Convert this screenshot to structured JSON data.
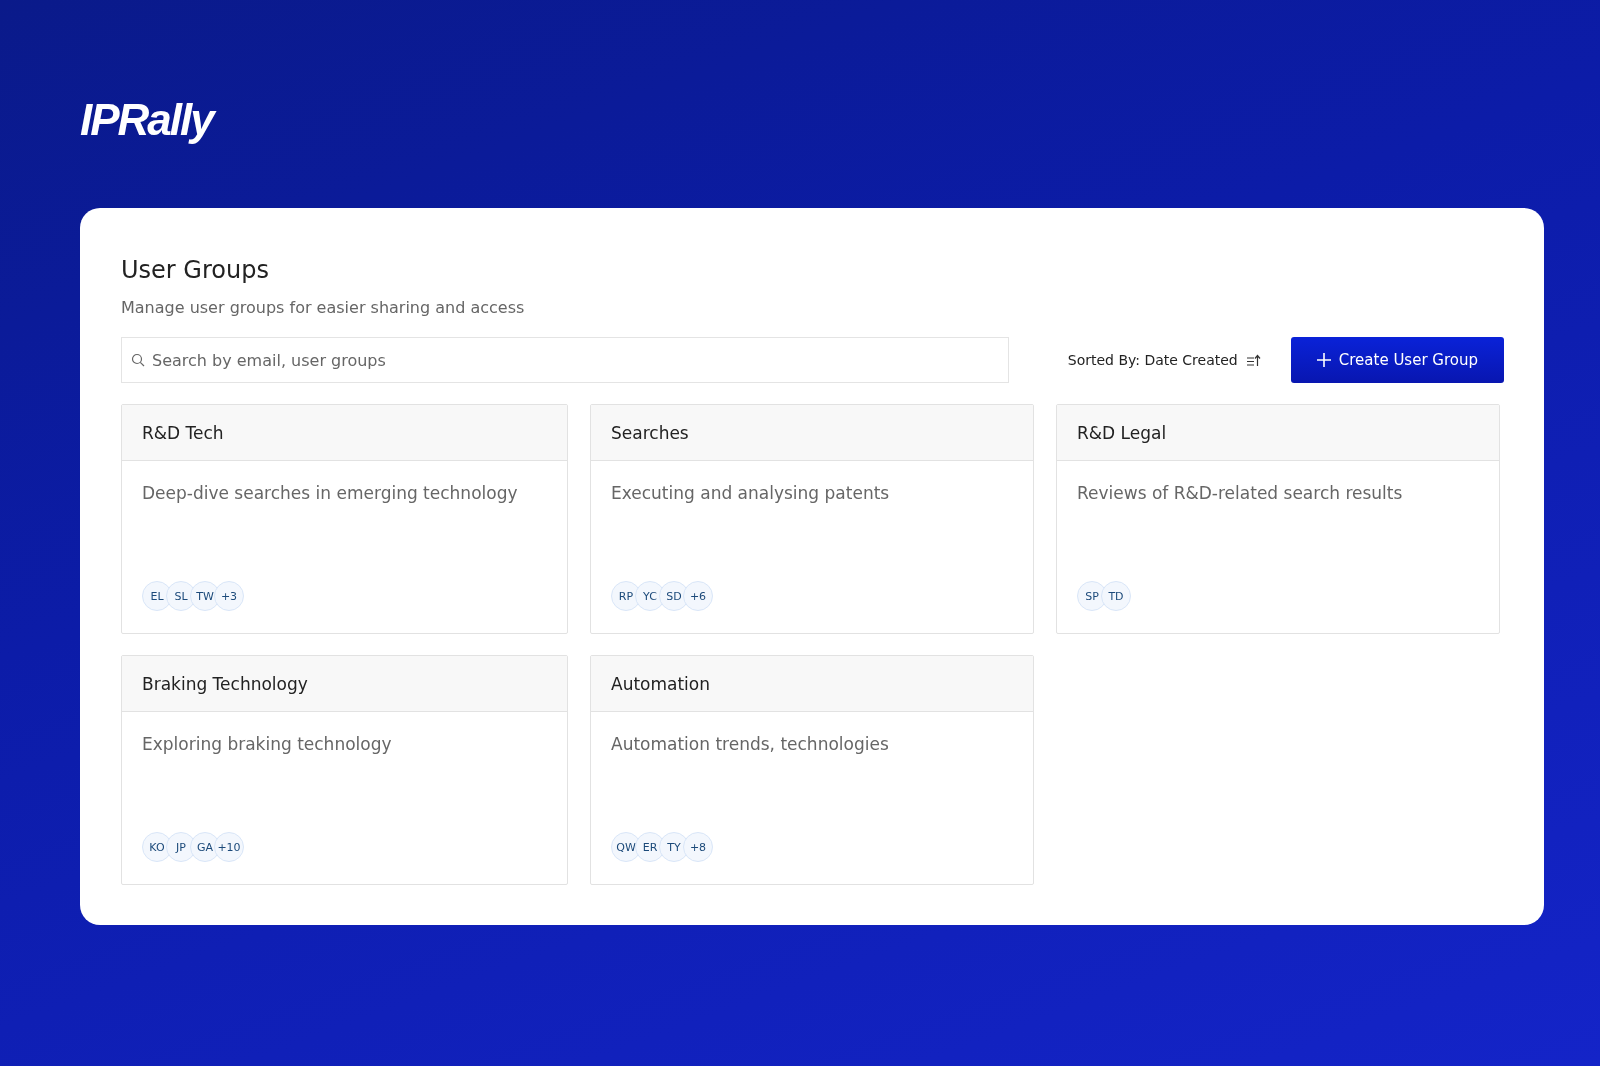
{
  "logo": "IPRally",
  "page": {
    "title": "User Groups",
    "subtitle": "Manage user groups for easier sharing and access"
  },
  "search": {
    "placeholder": "Search by email, user groups"
  },
  "sort": {
    "label": "Sorted By: Date Created"
  },
  "create_button": {
    "label": "Create User Group"
  },
  "groups": [
    {
      "name": "R&D Tech",
      "description": "Deep-dive searches in emerging technology",
      "members": [
        "EL",
        "SL",
        "TW",
        "+3"
      ]
    },
    {
      "name": "Searches",
      "description": "Executing and analysing patents",
      "members": [
        "RP",
        "YC",
        "SD",
        "+6"
      ]
    },
    {
      "name": "R&D Legal",
      "description": "Reviews of R&D-related search results",
      "members": [
        "SP",
        "TD"
      ]
    },
    {
      "name": "Braking Technology",
      "description": "Exploring braking technology",
      "members": [
        "KO",
        "JP",
        "GA",
        "+10"
      ]
    },
    {
      "name": "Automation",
      "description": "Automation trends, technologies",
      "members": [
        "QW",
        "ER",
        "TY",
        "+8"
      ]
    }
  ]
}
